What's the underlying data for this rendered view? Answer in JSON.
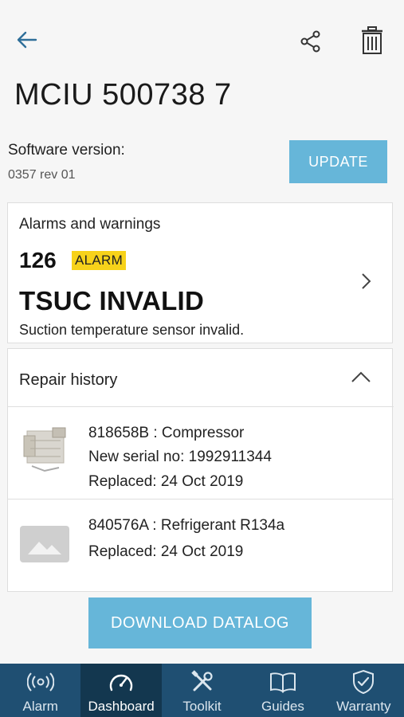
{
  "header": {
    "back_icon": "arrow-left-icon",
    "share_icon": "share-icon",
    "delete_icon": "trash-icon"
  },
  "device": {
    "title": "MCIU 500738 7",
    "software_label": "Software version:",
    "software_value": "0357 rev 01",
    "update_label": "UPDATE"
  },
  "alarms": {
    "heading": "Alarms and warnings",
    "code": "126",
    "badge": "ALARM",
    "name": "TSUC INVALID",
    "description": "Suction temperature sensor invalid.",
    "badge_color": "#f7d21a"
  },
  "repair_history": {
    "heading": "Repair history",
    "items": [
      {
        "part": "818658B : Compressor",
        "serial": "New serial no: 1992911344",
        "replaced": "Replaced: 24 Oct 2019"
      },
      {
        "part": "840576A : Refrigerant R134a",
        "replaced": "Replaced: 24 Oct 2019"
      }
    ]
  },
  "download_label": "DOWNLOAD DATALOG",
  "colors": {
    "accent": "#66b6d9",
    "nav_bg": "#1f4f72",
    "nav_active": "#13374f"
  },
  "nav": [
    {
      "label": "Alarm",
      "icon": "alarm-signal-icon"
    },
    {
      "label": "Dashboard",
      "icon": "dashboard-gauge-icon",
      "active": true
    },
    {
      "label": "Toolkit",
      "icon": "tools-icon"
    },
    {
      "label": "Guides",
      "icon": "book-icon"
    },
    {
      "label": "Warranty",
      "icon": "shield-check-icon"
    }
  ]
}
